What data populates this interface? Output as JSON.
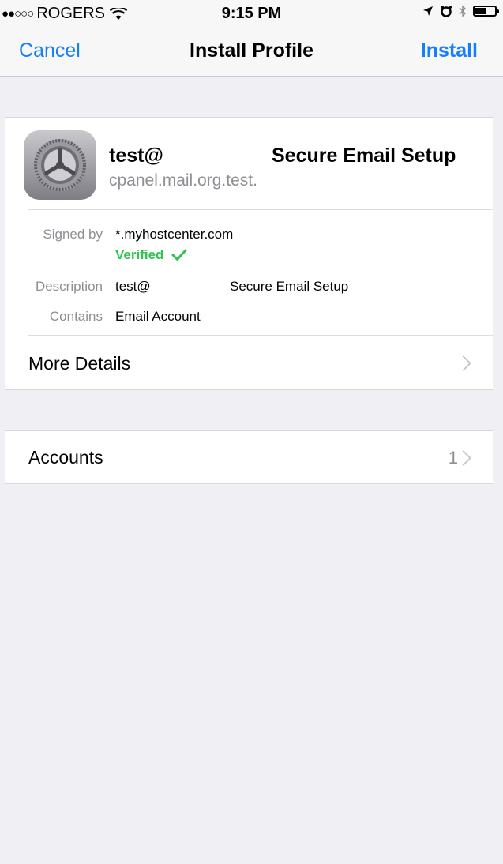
{
  "status_bar": {
    "signal": "●●○○○",
    "carrier": "ROGERS",
    "wifi_icon": "wifi-icon",
    "time": "9:15 PM",
    "location_icon": "location-arrow-icon",
    "alarm_icon": "alarm-clock-icon",
    "bluetooth_icon": "bluetooth-icon",
    "battery_icon": "battery-icon",
    "battery_level": 0.55
  },
  "nav": {
    "cancel": "Cancel",
    "title": "Install Profile",
    "install": "Install"
  },
  "profile": {
    "name_part1": "test@",
    "name_part2": "Secure Email Setup",
    "host": "cpanel.mail.org.test.",
    "icon": "settings-gear-icon"
  },
  "details": {
    "signed_by_label": "Signed by",
    "signed_by_value": "*.myhostcenter.com",
    "verified": "Verified",
    "verified_icon": "checkmark-icon",
    "description_label": "Description",
    "description_value_part1": "test@",
    "description_value_part2": "Secure Email Setup",
    "contains_label": "Contains",
    "contains_value": "Email Account"
  },
  "rows": {
    "more_details": "More Details",
    "accounts": "Accounts",
    "accounts_count": "1"
  },
  "colors": {
    "accent": "#147efb",
    "verified": "#2fc44f",
    "background": "#efeff4"
  }
}
